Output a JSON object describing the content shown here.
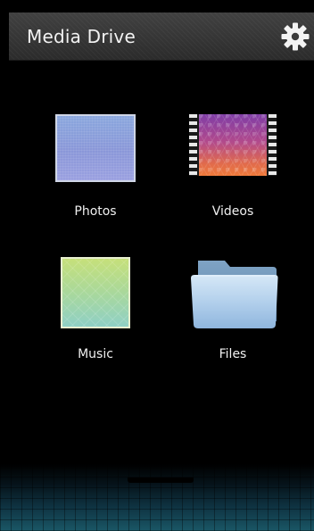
{
  "header": {
    "title": "Media Drive",
    "settings_icon": "gear-icon"
  },
  "tiles": [
    {
      "label": "Photos",
      "icon": "photos-icon"
    },
    {
      "label": "Videos",
      "icon": "videos-icon"
    },
    {
      "label": "Music",
      "icon": "music-icon"
    },
    {
      "label": "Files",
      "icon": "folder-icon"
    }
  ],
  "colors": {
    "background": "#000000",
    "header": "#3a3a3a",
    "label_text": "#f0f0f0",
    "dock_teal": "#1a5766"
  }
}
